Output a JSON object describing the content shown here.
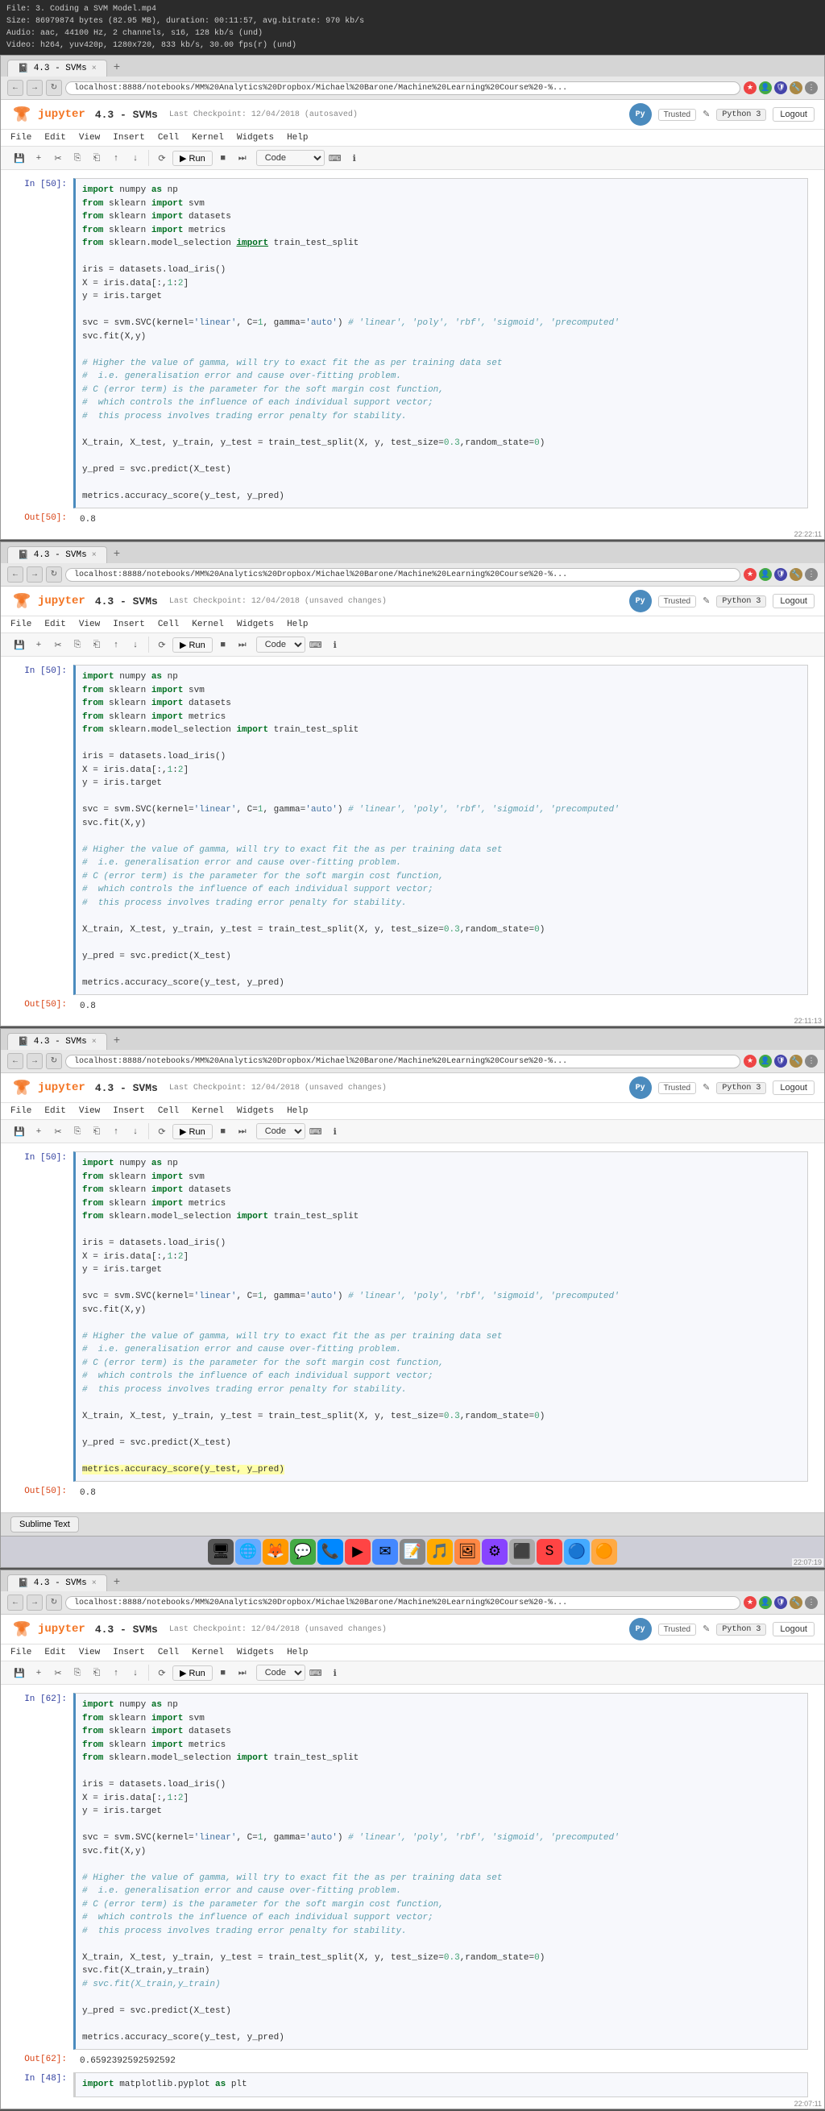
{
  "file_info": {
    "line1": "File: 3. Coding a SVM Model.mp4",
    "line2": "Size: 86979874 bytes (82.95 MB), duration: 00:11:57, avg.bitrate: 970 kb/s",
    "line3": "Audio: aac, 44100 Hz, 2 channels, s16, 128 kb/s (und)",
    "line4": "Video: h264, yuv420p, 1280x720, 833 kb/s, 30.00 fps(r) (und)"
  },
  "sections": [
    {
      "tab_label": "4.3 - SVMs",
      "checkpoint": "Last Checkpoint: 12/04/2018 (autosaved)",
      "address": "localhost:8888/notebooks/MM%20Analytics%20Dropbox/Michael%20Barone/Machine%20Learning%20Course%20-%...",
      "timestamp": "22:22:11",
      "cell_in": "In [50]:",
      "code": "import numpy as np\nfrom sklearn import svm\nfrom sklearn import datasets\nfrom sklearn import metrics\nfrom sklearn.model_selection import train_test_split\n\niris = datasets.load_iris()\nX = iris.data[:,1:2]\ny = iris.target\n\nsvc = svm.SVC(kernel='linear', C=1, gamma='auto') # 'linear', 'poly', 'rbf', 'sigmoid', 'precomputed'\nsvc.fit(X,y)\n\n# Higher the value of gamma, will try to exact fit the as per training data set\n#  i.e. generalisation error and cause over-fitting problem.\n# C (error term) is the parameter for the soft margin cost function,\n#  which controls the influence of each individual support vector;\n#  this process involves trading error penalty for stability.\n\nX_train, X_test, y_train, y_test = train_test_split(X, y, test_size=0.3,random_state=0)\n\ny_pred = svc.predict(X_test)\n\nmetrics.accuracy_score(y_test, y_pred)",
      "output_label": "Out[50]:",
      "output": "0.8",
      "has_underline_import": true,
      "unsaved": false
    },
    {
      "tab_label": "4.3 - SVMs",
      "checkpoint": "Last Checkpoint: 12/04/2018 (unsaved changes)",
      "address": "localhost:8888/notebooks/MM%20Analytics%20Dropbox/Michael%20Barone/Machine%20Learning%20Course%20-%...",
      "timestamp": "22:11:13",
      "cell_in": "In [50]:",
      "code": "import numpy as np\nfrom sklearn import svm\nfrom sklearn import datasets\nfrom sklearn import metrics\nfrom sklearn.model_selection import train_test_split\n\niris = datasets.load_iris()\nX = iris.data[:,1:2]\ny = iris.target\n\nsvc = svm.SVC(kernel='linear', C=1, gamma='auto') # 'linear', 'poly', 'rbf', 'sigmoid', 'precomputed'\nsvc.fit(X,y)\n\n# Higher the value of gamma, will try to exact fit the as per training data set\n#  i.e. generalisation error and cause over-fitting problem.\n# C (error term) is the parameter for the soft margin cost function,\n#  which controls the influence of each individual support vector;\n#  this process involves trading error penalty for stability.\n\nX_train, X_test, y_train, y_test = train_test_split(X, y, test_size=0.3,random_state=0)\n\ny_pred = svc.predict(X_test)\n\nmetrics.accuracy_score(y_test, y_pred)",
      "output_label": "Out[50]:",
      "output": "0.8",
      "unsaved": true
    },
    {
      "tab_label": "4.3 - SVMs",
      "checkpoint": "Last Checkpoint: 12/04/2018 (unsaved changes)",
      "address": "localhost:8888/notebooks/MM%20Analytics%20Dropbox/Michael%20Barone/Machine%20Learning%20Course%20-%...",
      "timestamp": "22:07:19",
      "cell_in": "In [50]:",
      "code": "import numpy as np\nfrom sklearn import svm\nfrom sklearn import datasets\nfrom sklearn import metrics\nfrom sklearn.model_selection import train_test_split\n\niris = datasets.load_iris()\nX = iris.data[:,1:2]\ny = iris.target\n\nsvc = svm.SVC(kernel='linear', C=1, gamma='auto') # 'linear', 'poly', 'rbf', 'sigmoid', 'precomputed'\nsvc.fit(X,y)\n\n# Higher the value of gamma, will try to exact fit the as per training data set\n#  i.e. generalisation error and cause over-fitting problem.\n# C (error term) is the parameter for the soft margin cost function,\n#  which controls the influence of each individual support vector;\n#  this process involves trading error penalty for stability.\n\nX_train, X_test, y_train, y_test = train_test_split(X, y, test_size=0.3,random_state=0)\n\ny_pred = svc.predict(X_test)\n\nmetrics.accuracy_score(y_test, y_pred)",
      "output_label": "Out[50]:",
      "output": "0.8",
      "has_sublime": true,
      "unsaved": true
    },
    {
      "tab_label": "4.3 - SVMs",
      "checkpoint": "Last Checkpoint: 12/04/2018 (unsaved changes)",
      "address": "localhost:8888/notebooks/MM%20Analytics%20Dropbox/Michael%20Barone/Machine%20Learning%20Course%20-%...",
      "timestamp": "22:07:11",
      "cell_in": "In [62]:",
      "code": "import numpy as np\nfrom sklearn import svm\nfrom sklearn import datasets\nfrom sklearn import metrics\nfrom sklearn.model_selection import train_test_split\n\niris = datasets.load_iris()\nX = iris.data[:,1:2]\ny = iris.target\n\nsvc = svm.SVC(kernel='linear', C=1, gamma='auto') # 'linear', 'poly', 'rbf', 'sigmoid', 'precomputed'\nsvc.fit(X,y)\n\n# Higher the value of gamma, will try to exact fit the as per training data set\n#  i.e. generalisation error and cause over-fitting problem.\n# C (error term) is the parameter for the soft margin cost function,\n#  which controls the influence of each individual support vector;\n#  this process involves trading error penalty for stability.\n\nX_train, X_test, y_train, y_test = train_test_split(X, y, test_size=0.3,random_state=0)\nsvc.fit(X_train,y_train)\n# svc.fit(X_train,y_train)\n\ny_pred = svc.predict(X_test)\n\nmetrics.accuracy_score(y_test, y_pred)",
      "output_label": "Out[62]:",
      "output": "0.6592392592592592",
      "next_cell_in": "In [48]:",
      "next_code": "import matplotlib.pyplot as plt",
      "unsaved": true
    }
  ],
  "ui": {
    "tab_close": "×",
    "tab_new": "+",
    "nav_back": "←",
    "nav_forward": "→",
    "nav_refresh": "↻",
    "jupyter_brand": "jupyter",
    "notebook_name": "4.3 - SVMs",
    "logout_label": "Logout",
    "trusted_label": "Trusted",
    "pencil_label": "✎",
    "python_label": "Python 3",
    "menu_items": [
      "File",
      "Edit",
      "View",
      "Insert",
      "Cell",
      "Kernel",
      "Widgets",
      "Help"
    ],
    "cell_type": "Code",
    "run_label": "▶ Run",
    "sublime_text_label": "Sublime Text",
    "dock_icons": [
      "🖥",
      "📁",
      "🔵",
      "🟠",
      "🟢",
      "🔴",
      "🌐",
      "📧",
      "🎵",
      "🖼",
      "📝",
      "⚙"
    ]
  }
}
